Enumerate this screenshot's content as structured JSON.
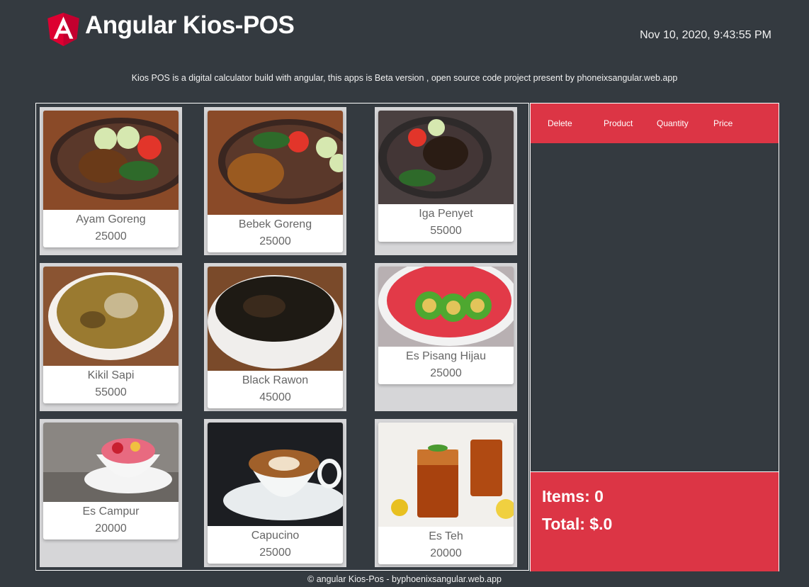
{
  "header": {
    "title": "Angular Kios-POS",
    "datetime": "Nov 10, 2020, 9:43:55 PM",
    "subtitle": "Kios POS is a digital calculator build with angular, this apps is Beta version , open source code project present by phoneixsangular.web.app"
  },
  "products": [
    {
      "name": "Ayam Goreng",
      "price": "25000",
      "icon": "fried-chicken-plate"
    },
    {
      "name": "Bebek Goreng",
      "price": "25000",
      "icon": "fried-duck-plate"
    },
    {
      "name": "Iga Penyet",
      "price": "55000",
      "icon": "ribs-plate"
    },
    {
      "name": "Kikil Sapi",
      "price": "55000",
      "icon": "soup-bowl"
    },
    {
      "name": "Black Rawon",
      "price": "45000",
      "icon": "black-soup-bowl"
    },
    {
      "name": "Es Pisang Hijau",
      "price": "25000",
      "icon": "green-banana-dessert"
    },
    {
      "name": "Es Campur",
      "price": "20000",
      "icon": "ice-dessert-bowl"
    },
    {
      "name": "Capucino",
      "price": "25000",
      "icon": "coffee-cup"
    },
    {
      "name": "Es Teh",
      "price": "20000",
      "icon": "iced-tea-glasses"
    }
  ],
  "cart": {
    "columns": [
      "Delete",
      "Product",
      "Quantity",
      "Price"
    ],
    "items_label": "Items: 0",
    "total_label": "Total: $.0"
  },
  "footer": "© angular Kios-Pos - byphoenixsangular.web.app",
  "colors": {
    "accent": "#dc3545",
    "background": "#343a40",
    "tile": "#d6d6d8"
  }
}
